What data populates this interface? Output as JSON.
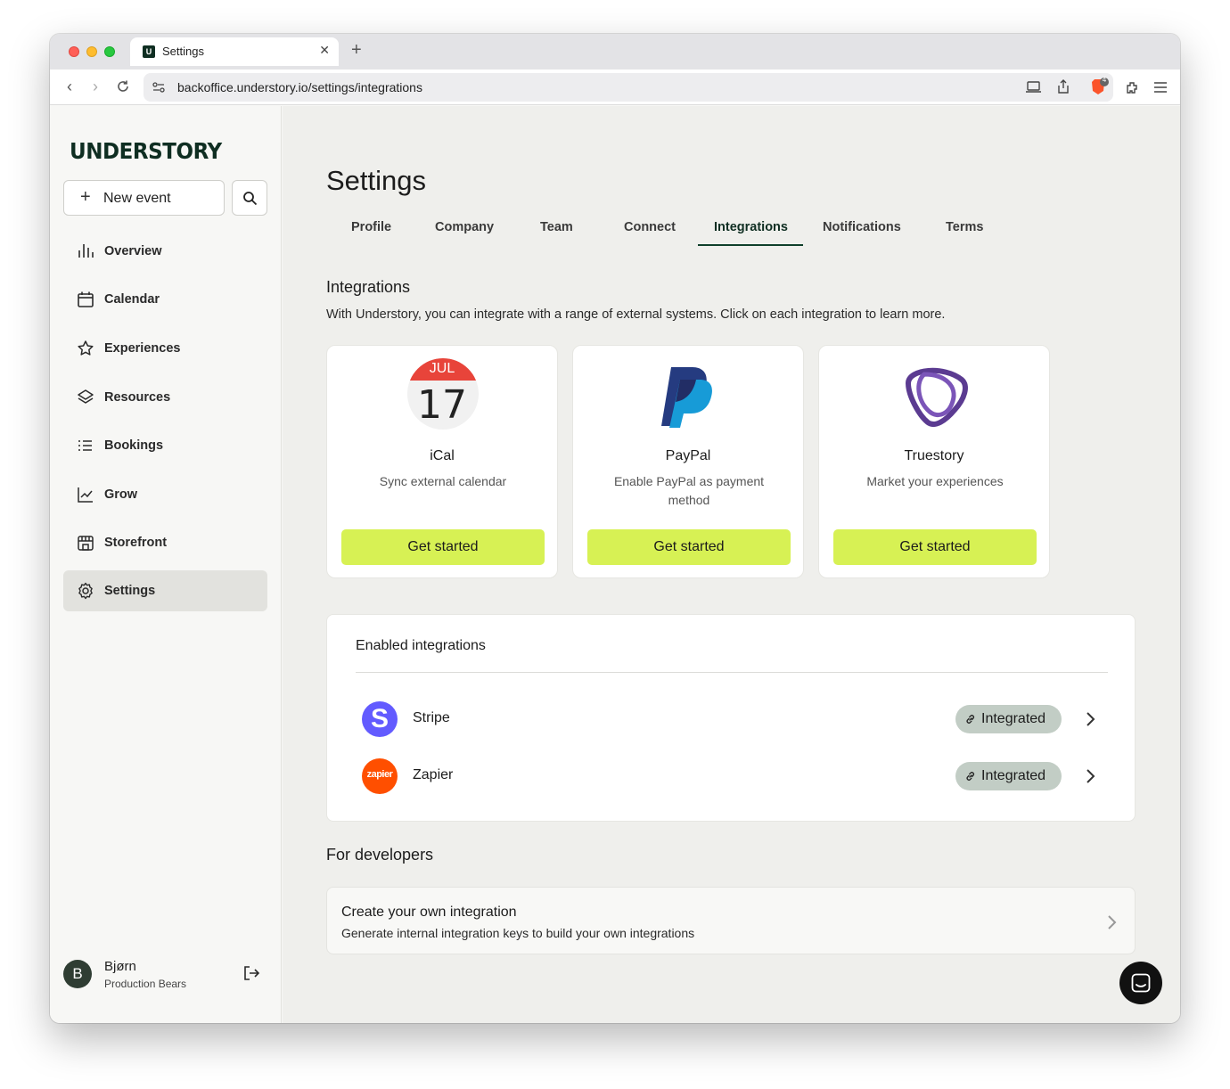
{
  "browser": {
    "tab_title": "Settings",
    "tab_favicon": "U",
    "url": "backoffice.understory.io/settings/integrations",
    "extension_badge": "4"
  },
  "sidebar": {
    "logo": "UNDERSTORY",
    "new_event_label": "New event",
    "items": [
      {
        "label": "Overview",
        "icon": "bar-chart-icon"
      },
      {
        "label": "Calendar",
        "icon": "calendar-icon"
      },
      {
        "label": "Experiences",
        "icon": "star-icon"
      },
      {
        "label": "Resources",
        "icon": "layers-icon"
      },
      {
        "label": "Bookings",
        "icon": "list-icon"
      },
      {
        "label": "Grow",
        "icon": "trend-icon"
      },
      {
        "label": "Storefront",
        "icon": "store-icon"
      },
      {
        "label": "Settings",
        "icon": "gear-icon",
        "active": true
      }
    ],
    "user": {
      "initial": "B",
      "name": "Bjørn",
      "org": "Production Bears"
    }
  },
  "main": {
    "title": "Settings",
    "tabs": [
      "Profile",
      "Company",
      "Team",
      "Connect",
      "Integrations",
      "Notifications",
      "Terms"
    ],
    "active_tab": "Integrations",
    "integrations_title": "Integrations",
    "integrations_desc": "With Understory, you can integrate with a range of external systems. Click on each integration to learn more.",
    "cards": [
      {
        "name": "iCal",
        "desc": "Sync external calendar",
        "cta": "Get started",
        "logo_month": "JUL",
        "logo_day": "17"
      },
      {
        "name": "PayPal",
        "desc": "Enable PayPal as payment method",
        "cta": "Get started"
      },
      {
        "name": "Truestory",
        "desc": "Market your experiences",
        "cta": "Get started"
      }
    ],
    "enabled_title": "Enabled integrations",
    "enabled": [
      {
        "name": "Stripe",
        "status": "Integrated",
        "logo_letter": "S",
        "color": "#635bff"
      },
      {
        "name": "Zapier",
        "status": "Integrated",
        "logo_text": "zapier",
        "color": "#ff4f00"
      }
    ],
    "developers_title": "For developers",
    "dev_card": {
      "title": "Create your own integration",
      "desc": "Generate internal integration keys to build your own integrations"
    }
  },
  "colors": {
    "accent": "#d7f154",
    "brand": "#0f2e22",
    "badge": "#c2cdc5"
  }
}
